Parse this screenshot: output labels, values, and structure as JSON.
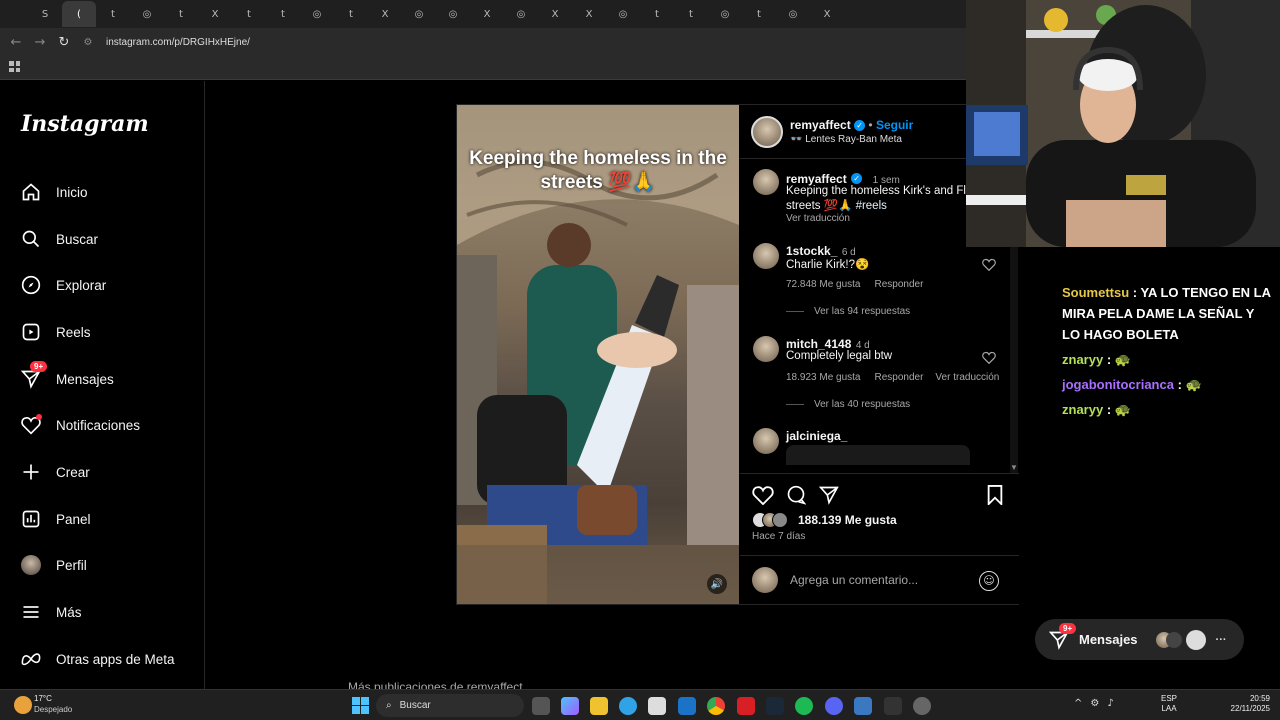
{
  "browser": {
    "tabs": [
      "S",
      "(",
      "t",
      "◎",
      "t",
      "X",
      "t",
      "t",
      "◎",
      "t",
      "X",
      "◎",
      "◎",
      "X",
      "◎",
      "X",
      "X",
      "◎",
      "t",
      "t",
      "◎",
      "t",
      "◎",
      "X"
    ],
    "active_tab_close": "✕",
    "url": "instagram.com/p/DRGIHxHEjne/"
  },
  "sidebar": {
    "logo": "Instagram",
    "items": [
      {
        "label": "Inicio",
        "icon": "home-icon"
      },
      {
        "label": "Buscar",
        "icon": "search-icon"
      },
      {
        "label": "Explorar",
        "icon": "compass-icon"
      },
      {
        "label": "Reels",
        "icon": "reels-icon"
      },
      {
        "label": "Mensajes",
        "icon": "messenger-icon",
        "badge": "9+"
      },
      {
        "label": "Notificaciones",
        "icon": "heart-icon"
      },
      {
        "label": "Crear",
        "icon": "plus-icon"
      },
      {
        "label": "Panel",
        "icon": "dashboard-icon"
      },
      {
        "label": "Perfil",
        "icon": "avatar"
      },
      {
        "label": "Más",
        "icon": "menu-icon"
      },
      {
        "label": "Otras apps de Meta",
        "icon": "meta-icon"
      }
    ]
  },
  "post": {
    "video_caption": "Keeping the homeless in the streets 💯🙏",
    "author": "remyaffect",
    "follow": "Seguir",
    "separator": "•",
    "subtitle": "👓 Lentes Ray-Ban Meta",
    "caption_user": "remyaffect",
    "caption_time": "1 sem",
    "caption_text": "Keeping the homeless Kirk's and Fle in the streets 💯🙏",
    "caption_tag": "#reels",
    "see_translation": "Ver traducción",
    "comments": [
      {
        "user": "1stockk_",
        "time": "6 d",
        "text": "Charlie Kirk!?😵",
        "likes": "72.848 Me gusta",
        "reply": "Responder",
        "translate": "",
        "replies": "Ver las 94 respuestas"
      },
      {
        "user": "mitch_4148",
        "time": "4 d",
        "text": "Completely legal btw",
        "likes": "18.923 Me gusta",
        "reply": "Responder",
        "translate": "Ver traducción",
        "replies": "Ver las 40 respuestas"
      },
      {
        "user": "jalciniega_",
        "time": "",
        "text": "",
        "likes": "",
        "reply": "",
        "translate": "",
        "replies": ""
      }
    ],
    "likes": "188.139 Me gusta",
    "posted": "Hace 7 días",
    "comment_placeholder": "Agrega un comentario...",
    "below_text": "Más publicaciones de remyaffect"
  },
  "chat": {
    "lines": [
      {
        "user": "Soumettsu",
        "sep": " : ",
        "text": "YA LO TENGO EN LA MIRA PELA DAME LA SEÑAL Y LO HAGO BOLETA",
        "color": "#e3c84a"
      },
      {
        "user": "znaryy",
        "sep": " : ",
        "text": "🐢",
        "color": "#b5e05a"
      },
      {
        "user": "jogabonitocrianca",
        "sep": " : ",
        "text": "🐢",
        "color": "#a970ff"
      },
      {
        "user": "znaryy",
        "sep": " : ",
        "text": "🐢",
        "color": "#b5e05a"
      }
    ]
  },
  "messages_pill": {
    "label": "Mensajes",
    "badge": "9+",
    "more": "···"
  },
  "taskbar": {
    "weather_temp": "17°C",
    "weather_desc": "Despejado",
    "search": "Buscar",
    "lang1": "ESP",
    "lang2": "LAA",
    "time": "20:59",
    "date": "22/11/2025"
  },
  "colors": {
    "accent": "#0095f6",
    "badge": "#ff3040",
    "bg": "#000000"
  }
}
